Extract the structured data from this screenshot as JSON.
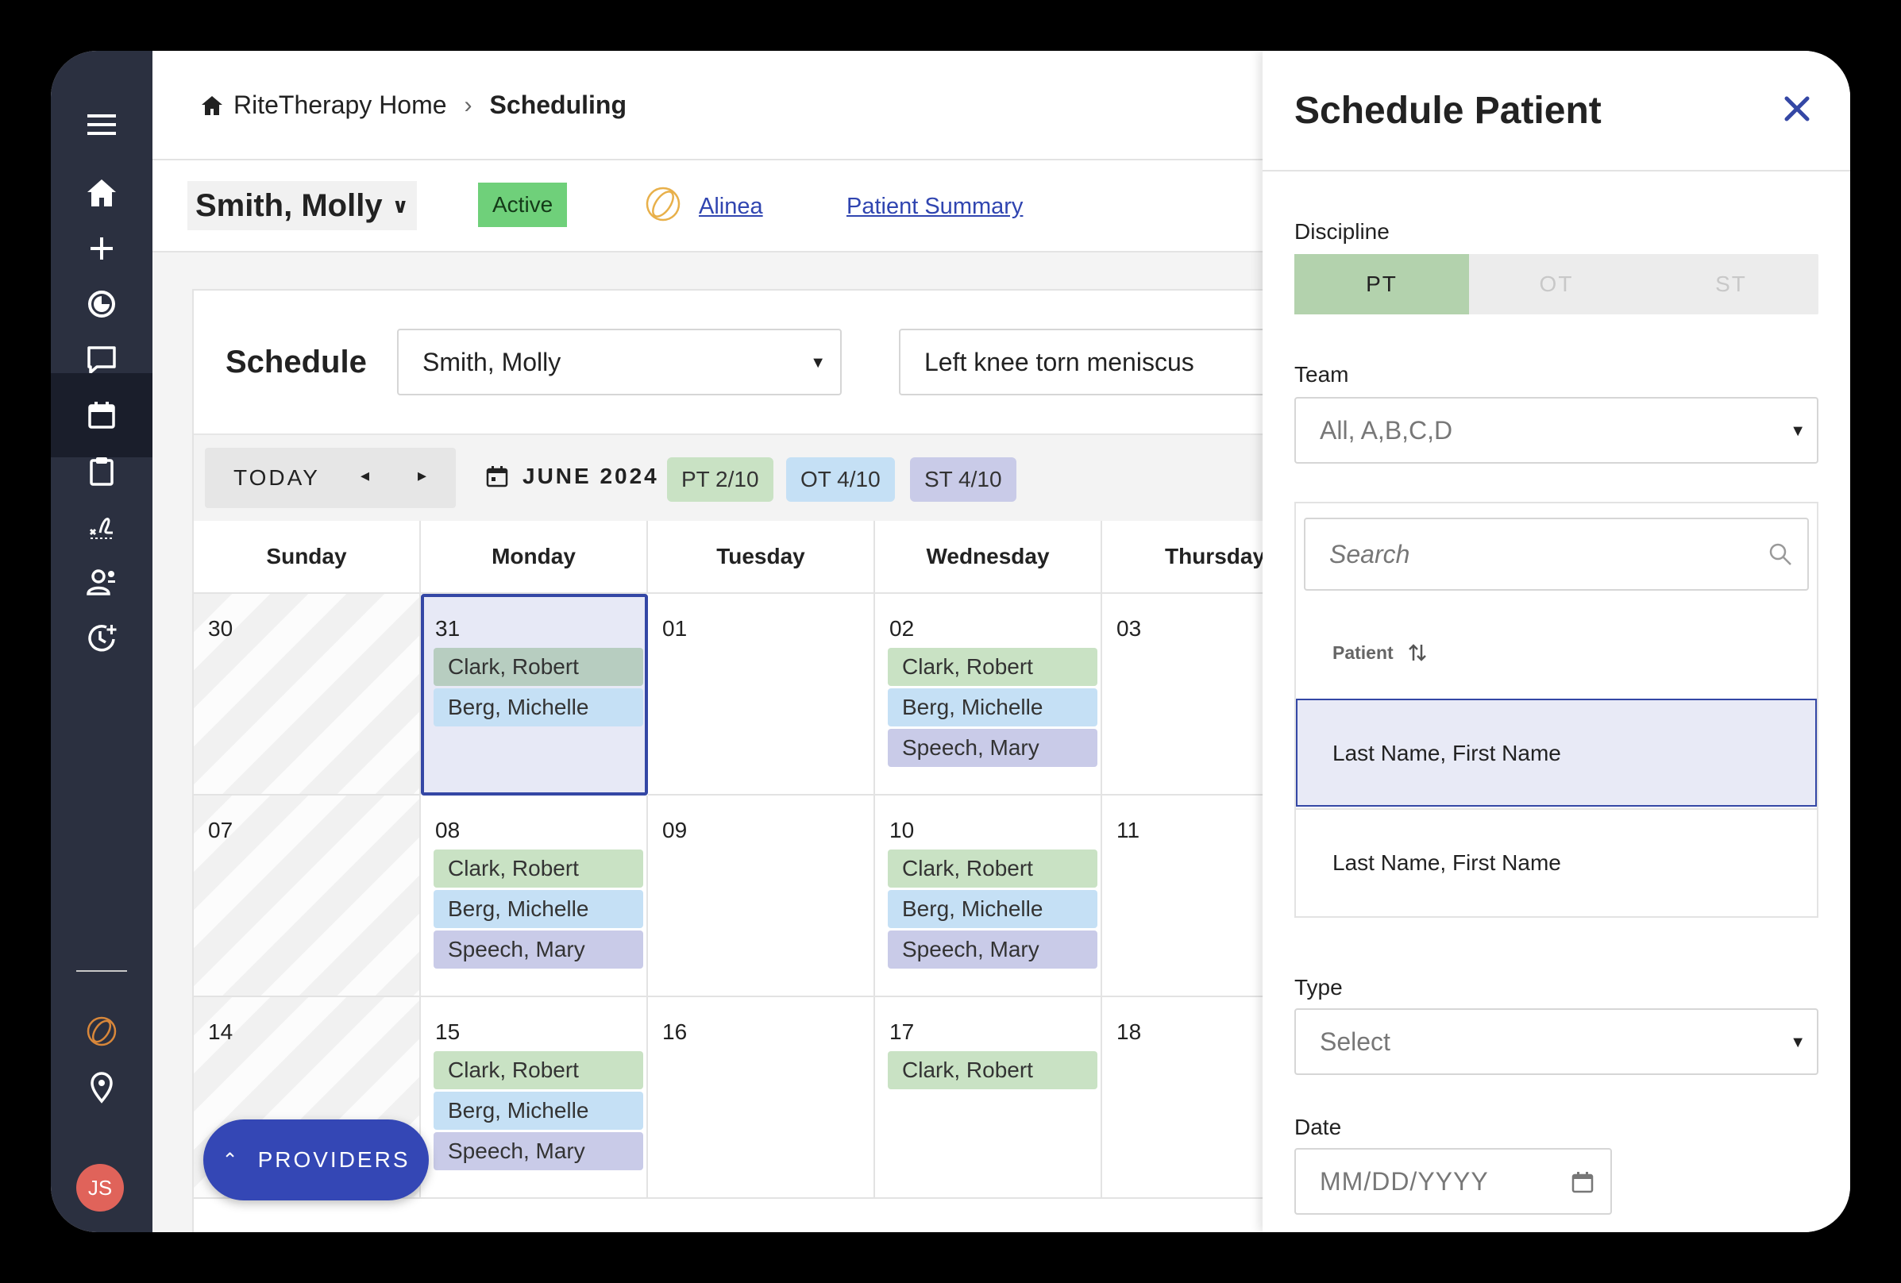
{
  "breadcrumb": {
    "home": "RiteTherapy Home",
    "current": "Scheduling"
  },
  "patient": {
    "name": "Smith, Molly",
    "status": "Active",
    "links": [
      "Alinea",
      "Patient Summary"
    ]
  },
  "schedule": {
    "title": "Schedule",
    "patient_select": "Smith, Molly",
    "diagnosis_select": "Left knee torn meniscus",
    "today_label": "TODAY",
    "month_label": "JUNE 2024",
    "pills": {
      "pt": "PT 2/10",
      "ot": "OT 4/10",
      "st": "ST 4/10"
    },
    "weekdays": [
      "Sunday",
      "Monday",
      "Tuesday",
      "Wednesday",
      "Thursday"
    ],
    "weeks": [
      {
        "days": [
          {
            "num": "30",
            "appts": []
          },
          {
            "num": "31",
            "appts": [
              "Clark, Robert",
              "Berg, Michelle"
            ]
          },
          {
            "num": "01",
            "appts": []
          },
          {
            "num": "02",
            "appts": [
              "Clark, Robert",
              "Berg, Michelle",
              "Speech, Mary"
            ]
          },
          {
            "num": "03",
            "appts": []
          }
        ]
      },
      {
        "days": [
          {
            "num": "07",
            "appts": []
          },
          {
            "num": "08",
            "appts": [
              "Clark, Robert",
              "Berg, Michelle",
              "Speech, Mary"
            ]
          },
          {
            "num": "09",
            "appts": []
          },
          {
            "num": "10",
            "appts": [
              "Clark, Robert",
              "Berg, Michelle",
              "Speech, Mary"
            ]
          },
          {
            "num": "11",
            "appts": []
          }
        ]
      },
      {
        "days": [
          {
            "num": "14",
            "appts": []
          },
          {
            "num": "15",
            "appts": [
              "Clark, Robert",
              "Berg, Michelle",
              "Speech, Mary"
            ]
          },
          {
            "num": "16",
            "appts": []
          },
          {
            "num": "17",
            "appts": [
              "Clark, Robert"
            ]
          },
          {
            "num": "18",
            "appts": []
          }
        ]
      }
    ],
    "providers_button": "PROVIDERS"
  },
  "drawer": {
    "title": "Schedule Patient",
    "discipline_label": "Discipline",
    "disciplines": [
      "PT",
      "OT",
      "ST"
    ],
    "selected_discipline": "PT",
    "team_label": "Team",
    "team_value": "All, A,B,C,D",
    "search_placeholder": "Search",
    "patient_column": "Patient",
    "patient_rows": [
      "Last Name, First Name",
      "Last Name, First Name"
    ],
    "type_label": "Type",
    "type_value": "Select",
    "date_label": "Date",
    "date_placeholder": "MM/DD/YYYY"
  },
  "user": {
    "initials": "JS"
  },
  "colors": {
    "sidebar": "#2b3040",
    "accent": "#3447b5",
    "pt": "#c9e2c4",
    "ot": "#c5e0f5",
    "st": "#c9cbe8",
    "active_badge": "#6fd07a"
  },
  "icons": [
    "menu-icon",
    "home-icon",
    "plus-icon",
    "chart-icon",
    "chat-icon",
    "calendar-icon",
    "clipboard-icon",
    "signature-icon",
    "team-icon",
    "history-icon",
    "alinea-icon",
    "location-icon"
  ]
}
